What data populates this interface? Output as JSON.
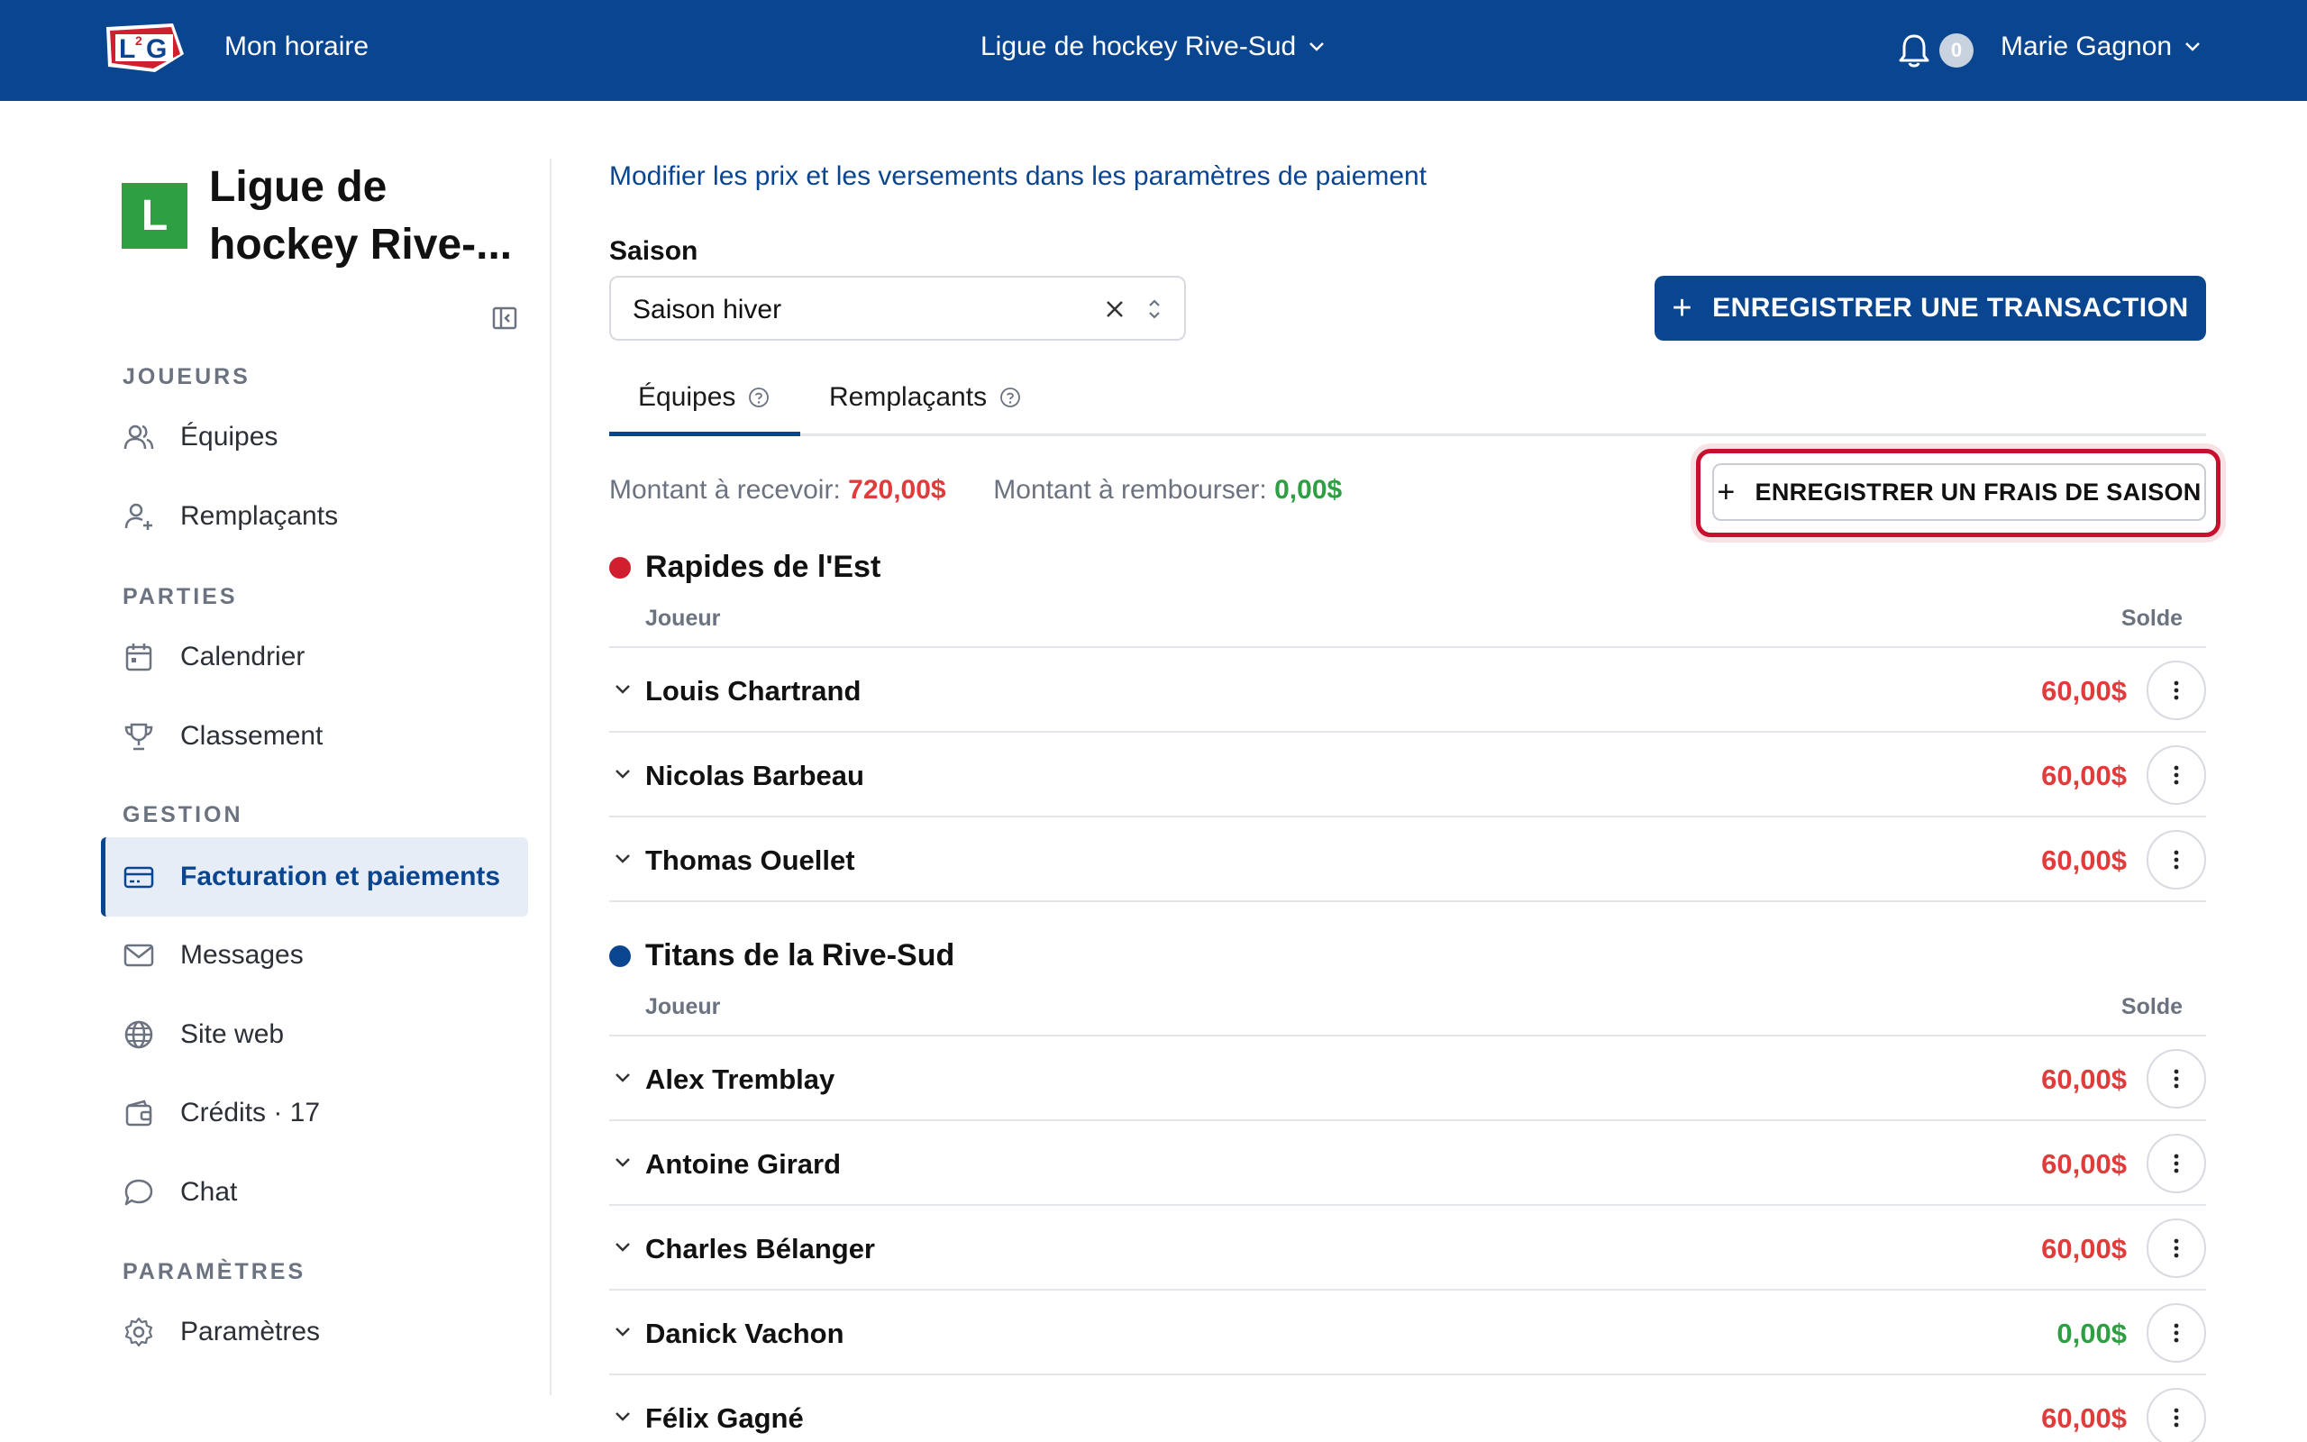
{
  "topbar": {
    "schedule_link": "Mon horaire",
    "league": "Ligue de hockey Rive-Sud",
    "notification_count": "0",
    "user_name": "Marie Gagnon"
  },
  "sidebar": {
    "org_initial": "L",
    "org_name": "Ligue de hockey Rive-...",
    "sections": {
      "players": "JOUEURS",
      "games": "PARTIES",
      "management": "GESTION",
      "settings": "PARAMÈTRES"
    },
    "items": {
      "teams": "Équipes",
      "substitutes": "Remplaçants",
      "calendar": "Calendrier",
      "standings": "Classement",
      "billing": "Facturation et paiements",
      "messages": "Messages",
      "website": "Site web",
      "credits": "Crédits · 17",
      "chat": "Chat",
      "settings": "Paramètres"
    }
  },
  "main": {
    "payment_settings_link": "Modifier les prix et les versements dans les paramètres de paiement",
    "season_label": "Saison",
    "season_value": "Saison hiver",
    "record_transaction": "ENREGISTRER UNE TRANSACTION",
    "tabs": {
      "teams": "Équipes",
      "substitutes": "Remplaçants"
    },
    "receivable_label": "Montant à recevoir:",
    "receivable_value": "720,00$",
    "refund_label": "Montant à rembourser:",
    "refund_value": "0,00$",
    "record_season_fee": "ENREGISTRER UN FRAIS DE SAISON",
    "col_player": "Joueur",
    "col_balance": "Solde",
    "teams": [
      {
        "name": "Rapides de l'Est",
        "color": "#d0202f",
        "players": [
          {
            "name": "Louis Chartrand",
            "balance": "60,00$"
          },
          {
            "name": "Nicolas Barbeau",
            "balance": "60,00$"
          },
          {
            "name": "Thomas Ouellet",
            "balance": "60,00$"
          }
        ]
      },
      {
        "name": "Titans de la Rive-Sud",
        "color": "#0a4690",
        "players": [
          {
            "name": "Alex Tremblay",
            "balance": "60,00$"
          },
          {
            "name": "Antoine Girard",
            "balance": "60,00$"
          },
          {
            "name": "Charles Bélanger",
            "balance": "60,00$"
          },
          {
            "name": "Danick Vachon",
            "balance": "0,00$"
          },
          {
            "name": "Félix Gagné",
            "balance": "60,00$"
          }
        ]
      }
    ]
  },
  "colors": {
    "brand": "#0a4690",
    "owed": "#e23b3b",
    "settled": "#2ea043",
    "highlight": "#c8102e"
  }
}
